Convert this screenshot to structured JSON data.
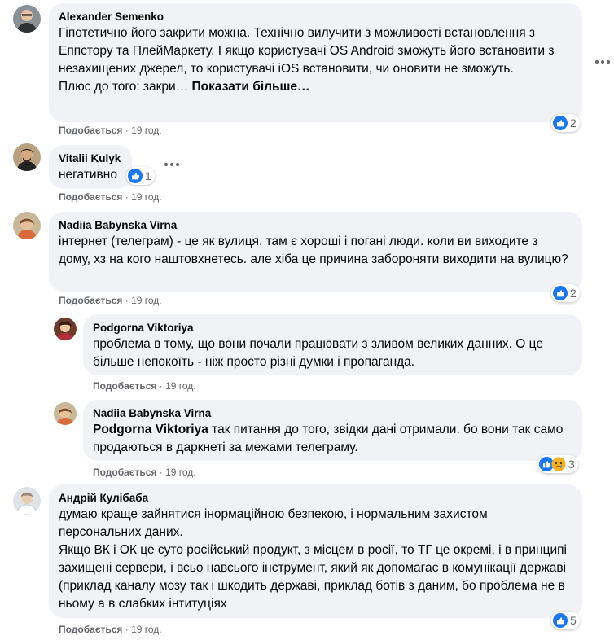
{
  "comments": [
    {
      "author": "Alexander Semenko",
      "text": "Гіпотетично його закрити можна. Технічно вилучити з можливості встановлення з Еппстору та ПлейМаркету. І якщо користувачі OS Android зможуть його встановити з незахищених джерел, то користувачі iOS встановити, чи оновити не зможуть.",
      "text2": "Плюс до того: закри…",
      "see_more": "Показати більше…",
      "like_label": "Подобається",
      "time": "19 год.",
      "reactions": "2"
    },
    {
      "author": "Vitalii Kulyk",
      "text": "негативно",
      "like_label": "Подобається",
      "time": "19 год.",
      "reactions": "1"
    },
    {
      "author": "Nadiia Babynska Virna",
      "text": "інтернет (телеграм) - це як вулиця. там є хороші і погані люди. коли ви виходите з дому, хз на кого наштовхнетесь. але хіба це причина забороняти виходити на вулицю?",
      "like_label": "Подобається",
      "time": "19 год.",
      "reactions": "2"
    },
    {
      "author": "Podgorna Viktoriya",
      "text": "проблема в тому, що вони почали працювати з зливом великих данних. О це більше непокоїть - ніж просто різні думки і пропаганда.",
      "like_label": "Подобається",
      "time": "19 год."
    },
    {
      "author": "Nadiia Babynska Virna",
      "mention": "Podgorna Viktoriya",
      "text": " так питання до того, звідки дані отримали. бо вони так само продаються в даркнеті за межами телеграму.",
      "like_label": "Подобається",
      "time": "19 год.",
      "reactions": "3"
    },
    {
      "author": "Андрій Кулібаба",
      "text": "думаю краще зайнятися інормаційною безпекою, і нормальним захистом персональних даних.",
      "text2": "Якщо ВК і ОК це суто російський продукт, з місцем в росії, то ТГ це окремі, і в принципі захищені сервери, і всьо навсього інструмент, який як допомагає в комунікації державі (приклад каналу мозу так і шкодить державі, приклад ботів з даним, бо проблема не в ньому а в слабких інтитуціях",
      "like_label": "Подобається",
      "time": "19 год.",
      "reactions": "5"
    }
  ],
  "colors": {
    "like_blue": "#1877f2",
    "haha_yellow": "#f7b125",
    "bubble": "#f0f2f5",
    "meta": "#65676b"
  }
}
